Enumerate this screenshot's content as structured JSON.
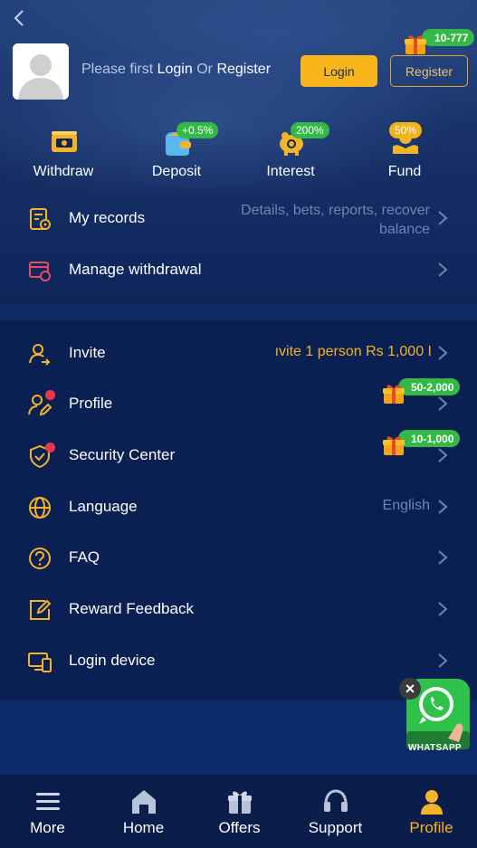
{
  "header": {
    "prompt_prefix": "Please first",
    "login_link": "Login",
    "or_text": "Or",
    "register_link": "Register",
    "login_button": "Login",
    "register_button": "Register",
    "register_reward": "10-777"
  },
  "quick_actions": [
    {
      "label": "Withdraw",
      "badge": "",
      "icon": "ticket-icon"
    },
    {
      "label": "Deposit",
      "badge": "+0.5%",
      "icon": "wallet-icon"
    },
    {
      "label": "Interest",
      "badge": "200%",
      "icon": "piggy-bank-icon"
    },
    {
      "label": "Fund",
      "badge": "50%",
      "icon": "hand-coin-icon"
    }
  ],
  "records": {
    "my_records_label": "My records",
    "my_records_hint_line1": "Details, bets, reports, recover",
    "my_records_hint_line2": "balance",
    "manage_withdrawal_label": "Manage withdrawal"
  },
  "menu": {
    "invite_label": "Invite",
    "invite_marquee": "ıvite 1 person Rs 1,000 I",
    "profile_label": "Profile",
    "profile_reward": "50-2,000",
    "security_label": "Security Center",
    "security_reward": "10-1,000",
    "language_label": "Language",
    "language_value": "English",
    "faq_label": "FAQ",
    "reward_feedback_label": "Reward Feedback",
    "login_device_label": "Login device"
  },
  "whatsapp": {
    "label": "WHATSAPP",
    "close": "×"
  },
  "tabs": [
    {
      "label": "More",
      "active": false
    },
    {
      "label": "Home",
      "active": false
    },
    {
      "label": "Offers",
      "active": false
    },
    {
      "label": "Support",
      "active": false
    },
    {
      "label": "Profile",
      "active": true
    }
  ],
  "colors": {
    "accent_gold": "#f4b429",
    "badge_green": "#34b947",
    "background": "#0a1f50",
    "red_dot": "#e8384a"
  }
}
